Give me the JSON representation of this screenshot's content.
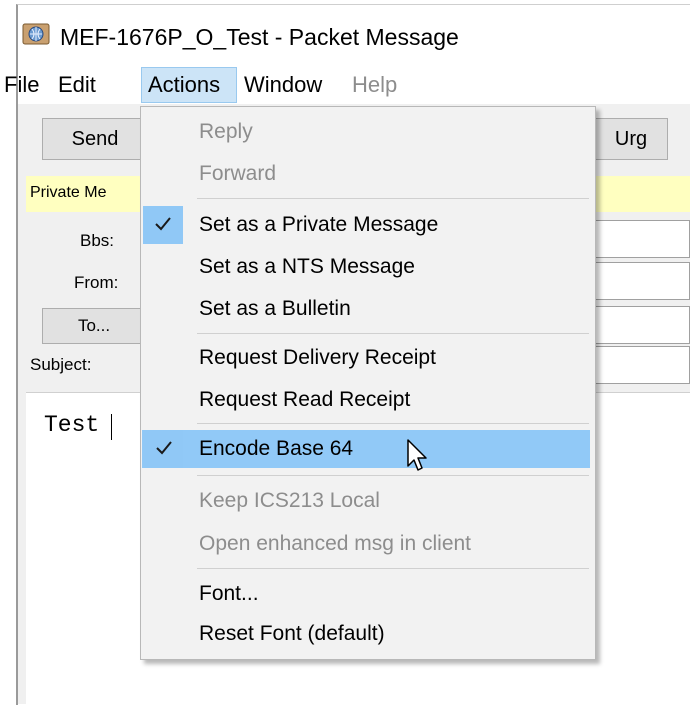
{
  "window": {
    "title": "MEF-1676P_O_Test - Packet Message",
    "icon": "app-globe-icon"
  },
  "menubar": {
    "items": [
      {
        "label": "File",
        "state": "normal"
      },
      {
        "label": "Edit",
        "state": "normal"
      },
      {
        "label": "Actions",
        "state": "open"
      },
      {
        "label": "Window",
        "state": "normal"
      },
      {
        "label": "Help",
        "state": "disabled"
      }
    ]
  },
  "toolbar": {
    "send_label": "Send",
    "urg_label": "Urg"
  },
  "status_bar_text": "Private Me",
  "form": {
    "bbs_label": "Bbs:",
    "from_label": "From:",
    "to_button_label": "To...",
    "subject_label": "Subject:"
  },
  "message_body": "Test",
  "actions_menu": {
    "items": [
      {
        "label": "Reply",
        "enabled": false,
        "checked": false
      },
      {
        "label": "Forward",
        "enabled": false,
        "checked": false
      },
      {
        "label": "Set as a Private Message",
        "enabled": true,
        "checked": true
      },
      {
        "label": "Set as a NTS Message",
        "enabled": true,
        "checked": false
      },
      {
        "label": "Set as a Bulletin",
        "enabled": true,
        "checked": false
      },
      {
        "label": "Request Delivery Receipt",
        "enabled": true,
        "checked": false
      },
      {
        "label": "Request Read Receipt",
        "enabled": true,
        "checked": false
      },
      {
        "label": "Encode Base 64",
        "enabled": true,
        "checked": true,
        "hovered": true
      },
      {
        "label": "Keep ICS213 Local",
        "enabled": false,
        "checked": false
      },
      {
        "label": "Open enhanced msg in client",
        "enabled": false,
        "checked": false
      },
      {
        "label": "Font...",
        "enabled": true,
        "checked": false
      },
      {
        "label": "Reset Font (default)",
        "enabled": true,
        "checked": false
      }
    ]
  },
  "colors": {
    "menu_highlight": "#91c9f7",
    "menubar_active": "#cce4f7",
    "status_bar": "#ffffc0",
    "disabled_text": "#8d8d8d"
  }
}
